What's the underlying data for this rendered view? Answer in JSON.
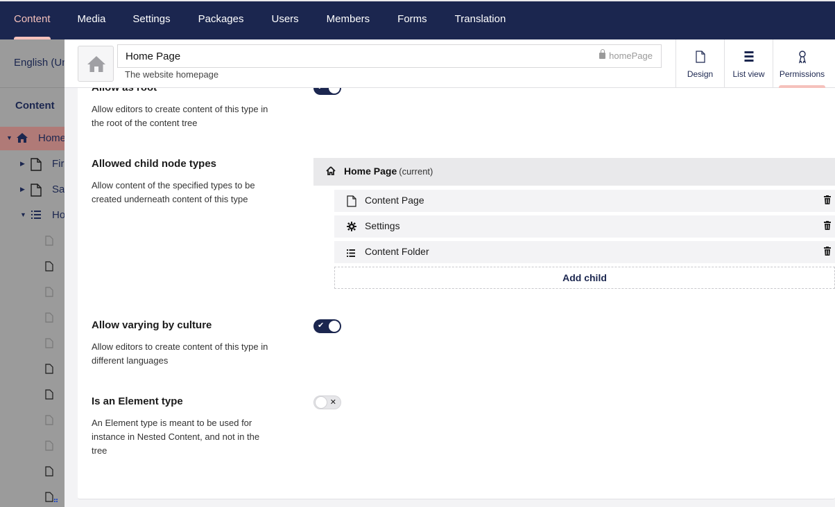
{
  "nav": {
    "items": [
      {
        "label": "Content",
        "active": true
      },
      {
        "label": "Media"
      },
      {
        "label": "Settings"
      },
      {
        "label": "Packages"
      },
      {
        "label": "Users"
      },
      {
        "label": "Members"
      },
      {
        "label": "Forms"
      },
      {
        "label": "Translation"
      }
    ]
  },
  "sidebar": {
    "language": "English (Un",
    "section_title": "Content",
    "tree": [
      {
        "label": "Home",
        "icon": "home-icon",
        "selected": true
      },
      {
        "label": "Fir",
        "icon": "document-icon"
      },
      {
        "label": "Sal",
        "icon": "document-icon"
      },
      {
        "label": "Ho",
        "icon": "list-icon"
      }
    ]
  },
  "header": {
    "name": "Home Page",
    "alias": "homePage",
    "description": "The website homepage",
    "apps": [
      {
        "label": "Design",
        "icon": "document-icon"
      },
      {
        "label": "List view",
        "icon": "list-view-icon"
      },
      {
        "label": "Permissions",
        "icon": "permissions-icon",
        "active": true
      }
    ]
  },
  "properties": {
    "allow_as_root": {
      "label": "Allow as root",
      "description": "Allow editors to create content of this type in the root of the content tree",
      "enabled": true
    },
    "allowed_children": {
      "label": "Allowed child node types",
      "description": "Allow content of the specified types to be created underneath content of this type",
      "parent_name": "Home Page",
      "parent_note": "(current)",
      "children": [
        {
          "name": "Content Page",
          "icon": "document-icon"
        },
        {
          "name": "Settings",
          "icon": "gear-icon"
        },
        {
          "name": "Content Folder",
          "icon": "list-icon"
        }
      ],
      "add_label": "Add child"
    },
    "vary_by_culture": {
      "label": "Allow varying by culture",
      "description": "Allow editors to create content of this type in different languages",
      "enabled": true
    },
    "element_type": {
      "label": "Is an Element type",
      "description": "An Element type is meant to be used for instance in Nested Content, and not in the tree",
      "enabled": false
    }
  },
  "colors": {
    "nav_bg": "#1b264f",
    "accent": "#f5c1bc",
    "sidebar_dim": "#9b9b9b"
  }
}
